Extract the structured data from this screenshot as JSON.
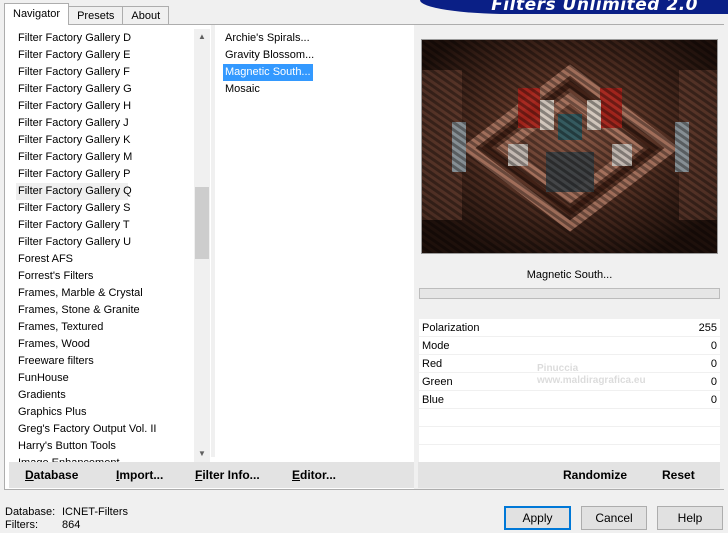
{
  "tabs": [
    {
      "label": "Navigator",
      "active": true
    },
    {
      "label": "Presets",
      "active": false
    },
    {
      "label": "About",
      "active": false
    }
  ],
  "banner": {
    "title": "Filters Unlimited 2.0"
  },
  "categories": [
    "Filter Factory Gallery D",
    "Filter Factory Gallery E",
    "Filter Factory Gallery F",
    "Filter Factory Gallery G",
    "Filter Factory Gallery H",
    "Filter Factory Gallery J",
    "Filter Factory Gallery K",
    "Filter Factory Gallery M",
    "Filter Factory Gallery P",
    "Filter Factory Gallery Q",
    "Filter Factory Gallery S",
    "Filter Factory Gallery T",
    "Filter Factory Gallery U",
    "Forest AFS",
    "Forrest's Filters",
    "Frames, Marble & Crystal",
    "Frames, Stone & Granite",
    "Frames, Textured",
    "Frames, Wood",
    "Freeware filters",
    "FunHouse",
    "Gradients",
    "Graphics Plus",
    "Greg's Factory Output Vol. II",
    "Harry's Button Tools",
    "Image Enhancement"
  ],
  "selected_category": "Filter Factory Gallery Q",
  "filters": [
    "Archie's Spirals...",
    "Gravity Blossom...",
    "Magnetic South...",
    "Mosaic"
  ],
  "selected_filter": "Magnetic South...",
  "preview": {
    "filter_name": "Magnetic South...",
    "progress": 0
  },
  "params": [
    {
      "label": "Polarization",
      "value": "255"
    },
    {
      "label": "Mode",
      "value": "0"
    },
    {
      "label": "Red",
      "value": "0"
    },
    {
      "label": "Green",
      "value": "0"
    },
    {
      "label": "Blue",
      "value": "0"
    }
  ],
  "toolbar": {
    "database": {
      "label": "Database",
      "underline": "D",
      "rest": "atabase"
    },
    "import": {
      "label": "Import...",
      "underline": "I",
      "rest": "mport..."
    },
    "filter_info": {
      "label": "Filter Info...",
      "underline": "F",
      "rest": "ilter Info..."
    },
    "editor": {
      "label": "Editor...",
      "underline": "E",
      "rest": "ditor..."
    },
    "randomize": "Randomize",
    "reset": "Reset"
  },
  "status": {
    "database_label": "Database:",
    "database_value": "ICNET-Filters",
    "filters_label": "Filters:",
    "filters_value": "864"
  },
  "buttons": {
    "apply": "Apply",
    "cancel": "Cancel",
    "help": "Help"
  },
  "watermark": {
    "line1": "Pinuccia",
    "line2": "www.maldiragrafica.eu"
  },
  "colors": {
    "selection": "#3399ff",
    "banner": "#0a1f86",
    "default_button_border": "#0078d7"
  }
}
